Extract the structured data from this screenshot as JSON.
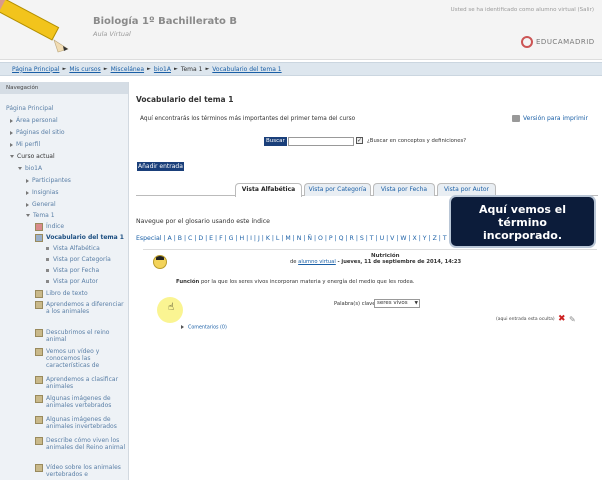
{
  "header": {
    "site_title": "Biología 1º Bachillerato B",
    "site_subtitle": "Aula Virtual",
    "login_info": "Usted se ha identificado como alumno virtual (Salir)",
    "logo_text": "EDUCAMADRID"
  },
  "breadcrumb": {
    "items": [
      "Página Principal",
      "Mis cursos",
      "Miscelánea",
      "bio1A",
      "Tema 1",
      "Vocabulario del tema 1"
    ]
  },
  "sidebar": {
    "title": "Navegación",
    "home": "Página Principal",
    "personal_area": "Área personal",
    "site_pages": "Páginas del sitio",
    "my_profile": "Mi perfil",
    "current_course": "Curso actual",
    "course": "bio1A",
    "participants": "Participantes",
    "badges": "Insignias",
    "general": "General",
    "topic": "Tema 1",
    "index": "Índice",
    "current_glossary": "Vocabulario del tema 1",
    "view_alpha": "Vista Alfabética",
    "view_category": "Vista por Categoría",
    "view_date": "Vista por Fecha",
    "view_author": "Vista por Autor",
    "activities": [
      "Libro de texto",
      "Aprendemos a diferenciar a los animales",
      "Descubrimos el reino animal",
      "Vemos un vídeo y conocemos las características de",
      "Aprendemos a clasificar animales",
      "Algunas imágenes de animales vertebrados",
      "Algunas imágenes de animales invertebrados",
      "Describe cómo viven los animales del Reino animal",
      "Vídeo sobre los animales vertebrados e"
    ]
  },
  "main": {
    "title": "Vocabulario del tema 1",
    "description": "Aquí encontrarás los términos más importantes del primer tema del curso",
    "print_link": "Versión para imprimir",
    "search_button": "Buscar",
    "search_value": "",
    "search_checkbox_label": "¿Buscar en conceptos y definiciones?",
    "add_entry": "Añadir entrada",
    "tabs": [
      "Vista Alfabética",
      "Vista por Categoría",
      "Vista por Fecha",
      "Vista por Autor"
    ],
    "browse_label": "Navegue por el glosario usando este índice",
    "letters": "Especial | A | B | C | D | E | F | G | H | I | J | K | L | M | N | Ñ | O | P | Q | R | S | T | U | V | W | X | Y | Z | T"
  },
  "callout": {
    "line1": "Aquí vemos el",
    "line2": "término",
    "line3": "incorporado."
  },
  "entry": {
    "concept": "Nutrición",
    "byline_prefix": "de",
    "author": "alumno virtual",
    "date": "- jueves, 11 de septiembre de 2014, 14:23",
    "definition_bold": "Función",
    "definition_rest": " por la que los seres vivos incorporan materia y energía del medio que les rodea.",
    "keyword_label": "Palabra(s) clave:",
    "keyword_value": "seres vivos",
    "meta": "(aqui entrada esta oculta)",
    "comments": "Comentarios (0)"
  },
  "colors": {
    "link": "#1a5fa6",
    "callout_bg": "#0c1c3a",
    "button_bg": "#1a3f7a"
  }
}
